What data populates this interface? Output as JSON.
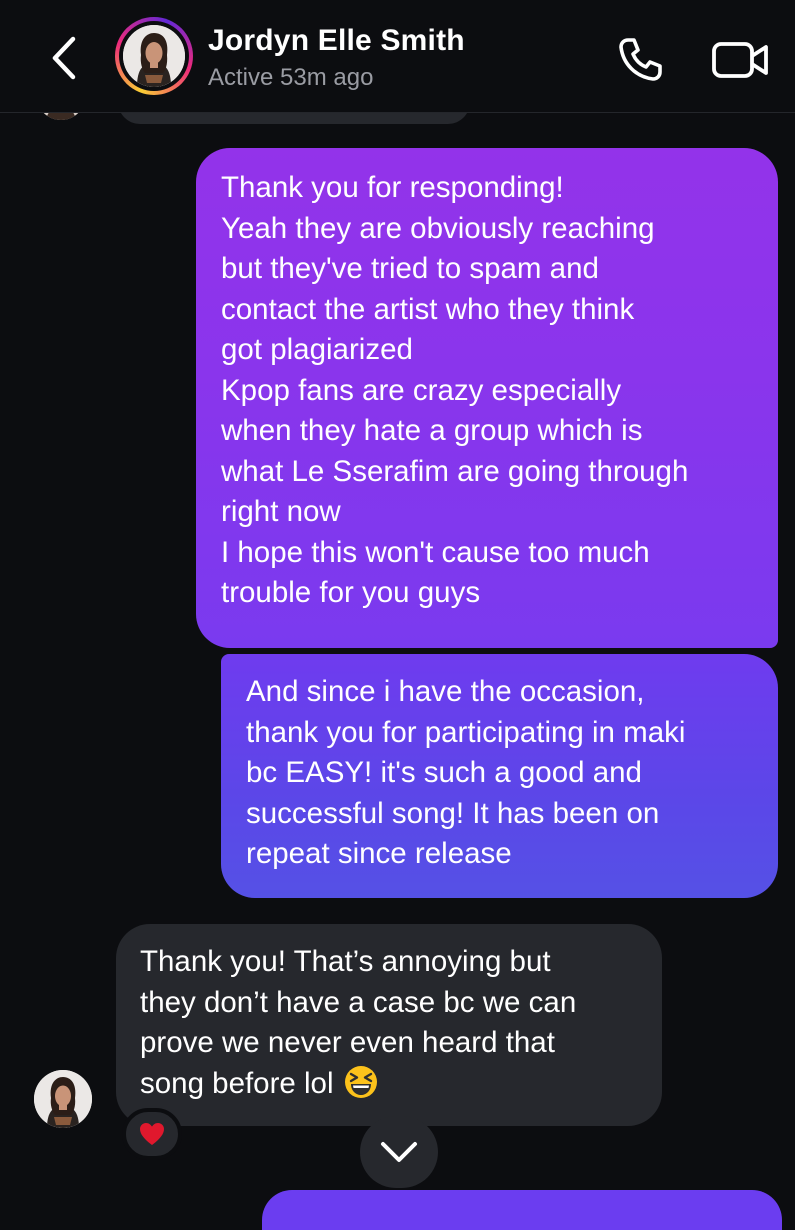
{
  "header": {
    "contact_name": "Jordyn Elle Smith",
    "status": "Active 53m ago",
    "icons": {
      "back": "chevron-left-icon",
      "call": "phone-icon",
      "video": "video-camera-icon"
    }
  },
  "messages": [
    {
      "direction": "sent",
      "lines": [
        "Thank you for responding!",
        "Yeah they are obviously reaching",
        "but they've tried to spam and",
        "contact the artist who they think",
        "got plagiarized",
        "Kpop fans are crazy especially",
        "when they hate a group which is",
        "what Le Sserafim are going through",
        "right now",
        "I hope this won't cause too much",
        "trouble for you guys"
      ]
    },
    {
      "direction": "sent",
      "lines": [
        "And since i have the occasion,",
        "thank you for participating in maki",
        "bc EASY! it's such a good and",
        "successful song! It has been on",
        "repeat since release"
      ]
    },
    {
      "direction": "received",
      "lines": [
        "Thank you! That’s annoying but",
        "they don’t have a case bc we can",
        "prove we never even heard that",
        "song before lol"
      ],
      "emoji": "grinning-squinting-face-icon",
      "reaction": "red-heart-icon"
    }
  ],
  "colors": {
    "background": "#0c0d10",
    "received_bubble": "#26282d",
    "sent_gradient_top": "#9333ea",
    "sent_gradient_bottom": "#5551e6",
    "status_text": "#9a9ca3"
  }
}
